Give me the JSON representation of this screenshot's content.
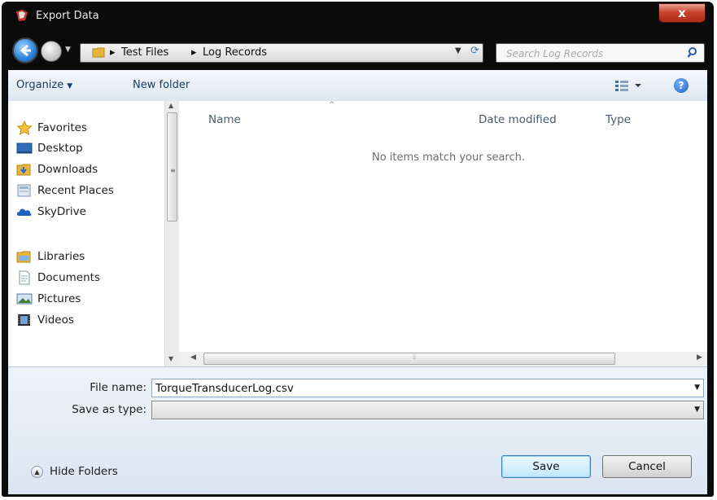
{
  "window": {
    "title": "Export Data",
    "close_glyph": "x"
  },
  "address": {
    "crumb_sep": "▸",
    "crumbs": [
      "Test Files",
      "Log Records"
    ],
    "search_placeholder": "Search Log Records"
  },
  "toolbar": {
    "organize_label": "Organize",
    "new_folder_label": "New folder",
    "help_glyph": "?"
  },
  "nav": {
    "favorites_label": "Favorites",
    "favorites": [
      "Desktop",
      "Downloads",
      "Recent Places",
      "SkyDrive"
    ],
    "libraries_label": "Libraries",
    "libraries": [
      "Documents",
      "Pictures",
      "Videos"
    ]
  },
  "file_list": {
    "columns": [
      "Name",
      "Date modified",
      "Type"
    ],
    "empty_message": "No items match your search."
  },
  "form": {
    "file_name_label": "File name:",
    "file_name_value": "TorqueTransducerLog.csv",
    "save_type_label": "Save as type:",
    "save_type_value": ""
  },
  "footer": {
    "hide_folders_label": "Hide Folders",
    "save_label": "Save",
    "cancel_label": "Cancel"
  },
  "colors": {
    "title_bar": "#0b0b0b",
    "close": "#c8452f",
    "link": "#1b3c66",
    "selection_border": "#3c7fb1"
  }
}
